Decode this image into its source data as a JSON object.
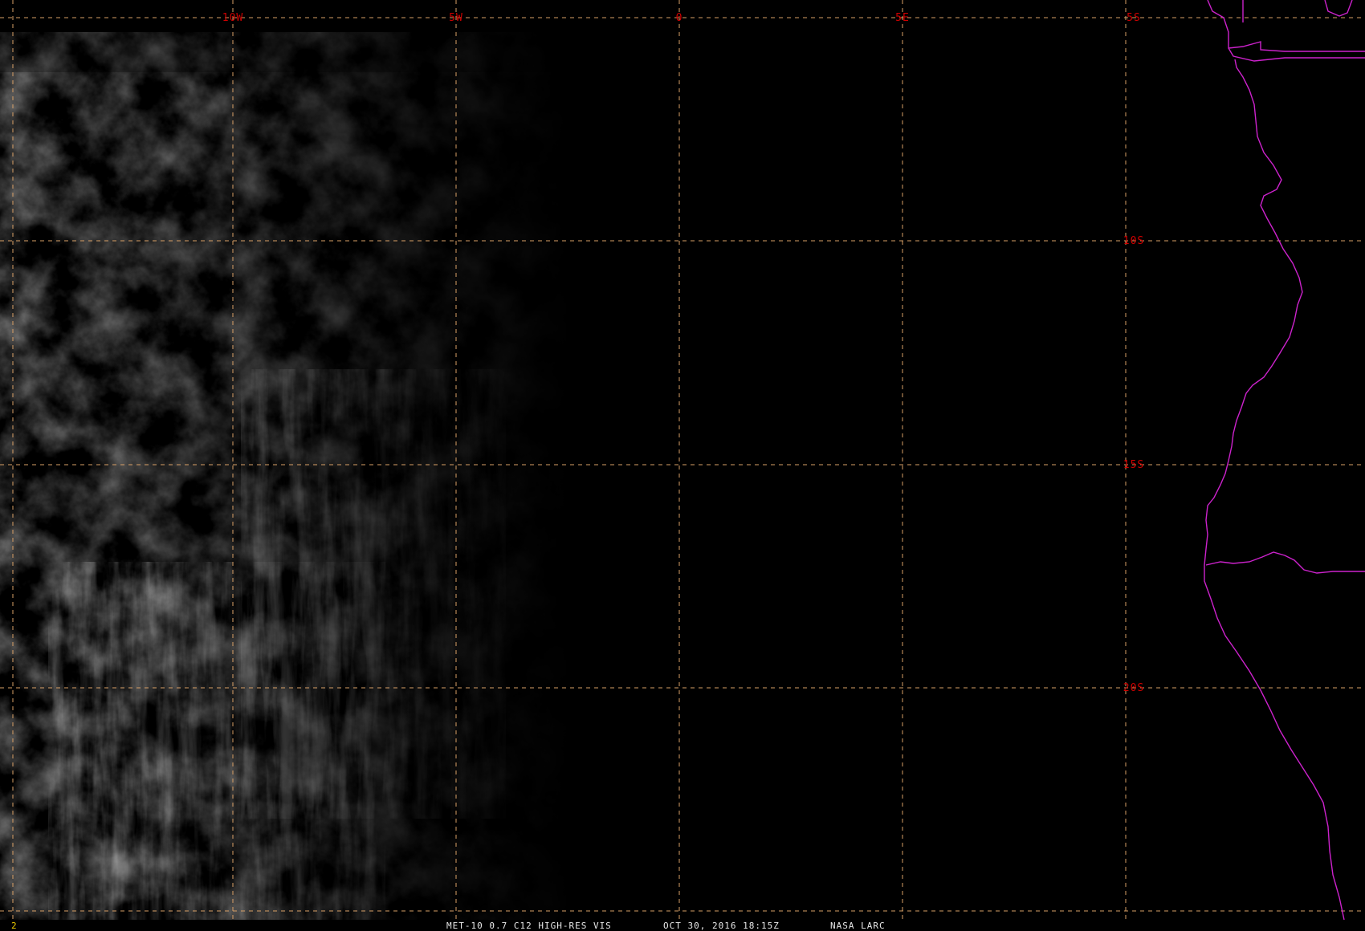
{
  "map": {
    "lon_labels": [
      "10W",
      "5W",
      "0",
      "5E"
    ],
    "lat_labels": [
      "5S",
      "10S",
      "15S",
      "20S"
    ],
    "colors": {
      "grid": "#d9a066",
      "grid_label": "#d00000",
      "coastline": "#cc22cc",
      "background": "#000000"
    }
  },
  "status": {
    "frame": "2",
    "satellite": "MET-10 0.7 C12 HIGH-RES VIS",
    "datetime": "OCT 30, 2016 18:15Z",
    "source": "NASA LARC"
  }
}
